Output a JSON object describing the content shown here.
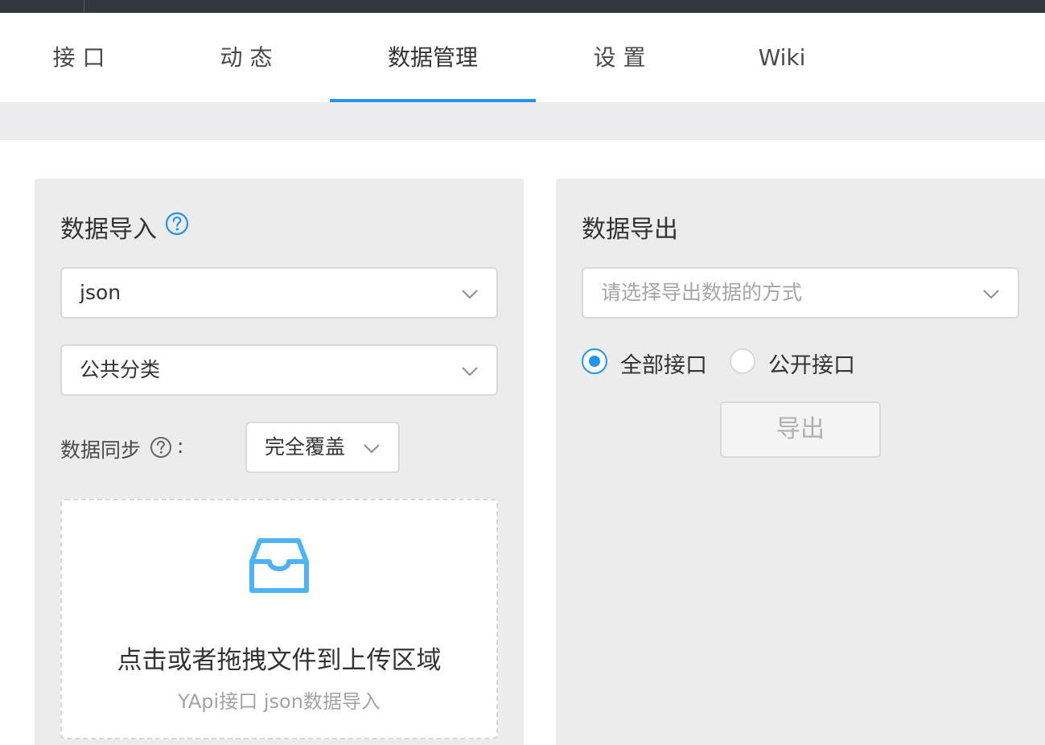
{
  "tabs": [
    {
      "label": "接 口",
      "active": false
    },
    {
      "label": "动 态",
      "active": false
    },
    {
      "label": "数据管理",
      "active": true
    },
    {
      "label": "设 置",
      "active": false
    },
    {
      "label": "Wiki",
      "active": false
    }
  ],
  "import_panel": {
    "title": "数据导入",
    "format_select": {
      "value": "json"
    },
    "category_select": {
      "value": "公共分类"
    },
    "sync_label": "数据同步",
    "sync_colon": ":",
    "sync_select": {
      "value": "完全覆盖"
    },
    "dropzone": {
      "title": "点击或者拖拽文件到上传区域",
      "hint": "YApi接口 json数据导入"
    }
  },
  "export_panel": {
    "title": "数据导出",
    "method_select": {
      "placeholder": "请选择导出数据的方式"
    },
    "radios": [
      {
        "label": "全部接口",
        "checked": true
      },
      {
        "label": "公开接口",
        "checked": false
      }
    ],
    "export_button": "导出"
  },
  "colors": {
    "accent": "#2395f1",
    "upload_icon": "#4db3f7",
    "topbar": "#32363f",
    "panel_bg": "#ececec"
  },
  "icons": {
    "help": "question-circle-icon",
    "chevron": "chevron-down-icon",
    "upload": "inbox-icon"
  }
}
